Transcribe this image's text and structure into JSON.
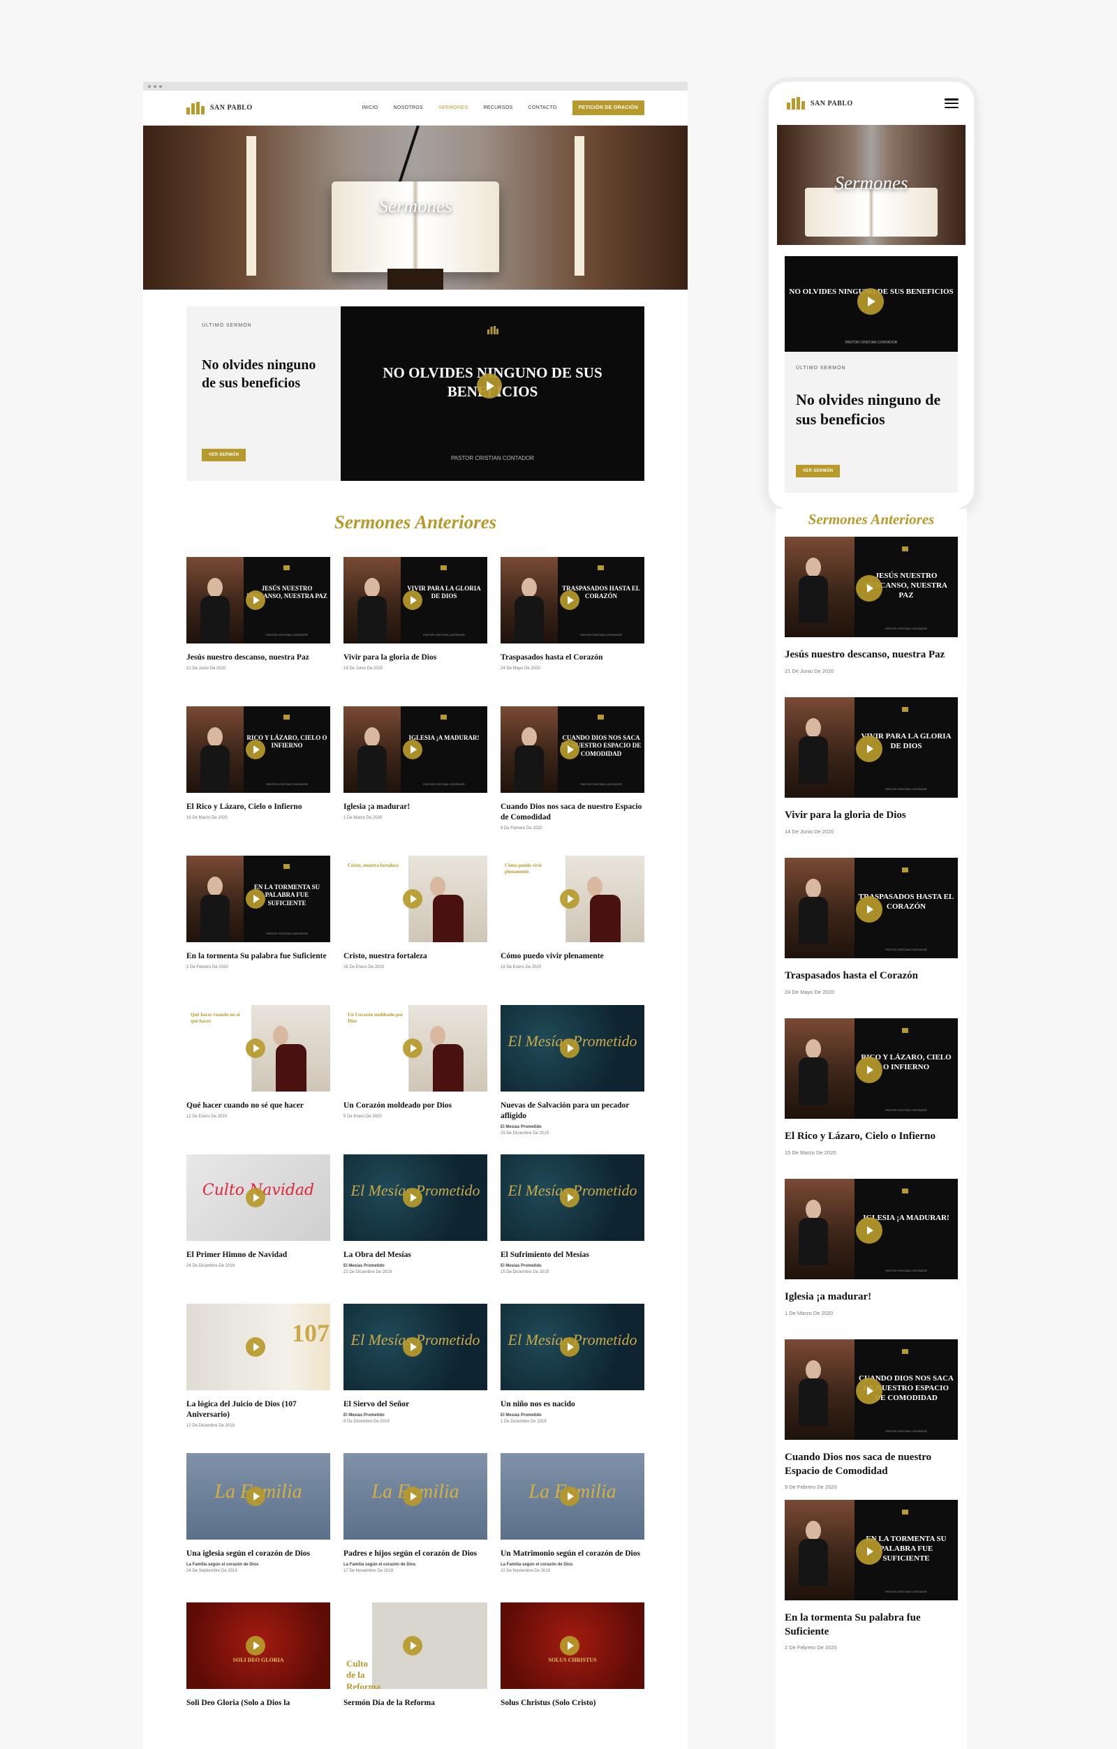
{
  "brand": {
    "name": "SAN PABLO",
    "accent": "#b79a2b"
  },
  "nav": {
    "items": [
      "INICIO",
      "NOSOTROS",
      "SERMONES",
      "RECURSOS",
      "CONTACTO"
    ],
    "cta": "PETICIÓN DE ORACIÓN"
  },
  "hero": {
    "title": "Sermones"
  },
  "latest": {
    "eyebrow": "ÚLTIMO SERMÓN",
    "title": "No olvides ninguno de sus beneficios",
    "button": "VER SERMÓN",
    "video_title": "NO OLVIDES NINGUNO DE SUS BENEFICIOS",
    "video_subtitle": "PASTOR CRISTIAN CONTADOR"
  },
  "previous": {
    "title": "Sermones Anteriores",
    "items": [
      {
        "title": "Jesús nuestro descanso, nuestra Paz",
        "date": "21 De Junio De 2020",
        "thumb": "JESÚS NUESTRO DESCANSO, NUESTRA PAZ",
        "style": "dark"
      },
      {
        "title": "Vivir para la gloria de Dios",
        "date": "14 De Junio De 2020",
        "thumb": "VIVIR PARA LA GLORIA DE DIOS",
        "style": "dark"
      },
      {
        "title": "Traspasados hasta el Corazón",
        "date": "24 De Mayo De 2020",
        "thumb": "TRASPASADOS HASTA EL CORAZÓN",
        "style": "dark"
      },
      {
        "title": "El Rico y Lázaro, Cielo o Infierno",
        "date": "15 De Marzo De 2020",
        "thumb": "RICO Y LÁZARO, CIELO O INFIERNO",
        "style": "dark"
      },
      {
        "title": "Iglesia ¡a madurar!",
        "date": "1 De Marzo De 2020",
        "thumb": "IGLESIA ¡A MADURAR!",
        "style": "dark"
      },
      {
        "title": "Cuando Dios nos saca de nuestro Espacio de Comodidad",
        "date": "9 De Febrero De 2020",
        "thumb": "CUANDO DIOS NOS SACA DE NUESTRO ESPACIO DE COMODIDAD",
        "style": "dark"
      },
      {
        "title": "En la tormenta Su palabra fue Suficiente",
        "date": "2 De Febrero De 2020",
        "thumb": "EN LA TORMENTA SU PALABRA FUE SUFICIENTE",
        "style": "dark"
      },
      {
        "title": "Cristo, nuestra fortaleza",
        "date": "26 De Enero De 2020",
        "thumb": "Cristo, nuestra fortaleza",
        "style": "light"
      },
      {
        "title": "Cómo puedo vivir plenamente",
        "date": "19 De Enero De 2020",
        "thumb": "Cómo puedo vivir plenamente",
        "style": "light"
      },
      {
        "title": "Qué hacer cuando no sé que hacer",
        "date": "12 De Enero De 2020",
        "thumb": "Qué hacer cuando no sé que hacer",
        "style": "light"
      },
      {
        "title": "Un Corazón moldeado por Dios",
        "date": "5 De Enero De 2020",
        "thumb": "Un Corazón moldeado por Dios",
        "style": "light"
      },
      {
        "title": "Nuevas de Salvación para un pecador afligido",
        "series": "El Mesías Prometido",
        "date": "29 De Diciembre De 2019",
        "thumb": "El Mesías Prometido",
        "style": "navy"
      },
      {
        "title": "El Primer Himno de Navidad",
        "date": "24 De Diciembre De 2019",
        "thumb": "Culto Navidad",
        "style": "gray"
      },
      {
        "title": "La Obra del Mesías",
        "series": "El Mesías Prometido",
        "date": "22 De Diciembre De 2019",
        "thumb": "El Mesías Prometido",
        "style": "navy"
      },
      {
        "title": "El Sufrimiento del Mesías",
        "series": "El Mesías Prometido",
        "date": "15 De Diciembre De 2019",
        "thumb": "El Mesías Prometido",
        "style": "navy"
      },
      {
        "title": "La lógica del Juicio de Dios (107 Aniversario)",
        "date": "12 De Diciembre De 2019",
        "thumb": "107",
        "style": "cream"
      },
      {
        "title": "El Siervo del Señor",
        "series": "El Mesías Prometido",
        "date": "8 De Diciembre De 2019",
        "thumb": "El Mesías Prometido",
        "style": "navy"
      },
      {
        "title": "Un niño nos es nacido",
        "series": "El Mesías Prometido",
        "date": "1 De Diciembre De 2019",
        "thumb": "El Mesías Prometido",
        "style": "navy"
      },
      {
        "title": "Una iglesia según el corazón de Dios",
        "series": "La Familia según el corazón de Dios",
        "date": "24 De Septiembre De 2019",
        "thumb": "La Familia",
        "style": "slate"
      },
      {
        "title": "Padres e hijos según el corazón de Dios",
        "series": "La Familia según el corazón de Dios",
        "date": "17 De Noviembre De 2019",
        "thumb": "La Familia",
        "style": "slate"
      },
      {
        "title": "Un Matrimonio según el corazón de Dios",
        "series": "La Familia según el corazón de Dios",
        "date": "10 De Noviembre De 2019",
        "thumb": "La Familia",
        "style": "slate"
      },
      {
        "title": "Soli Deo Gloria (Solo a Dios la",
        "date": "",
        "thumb": "SOLI DEO GLORIA",
        "style": "red"
      },
      {
        "title": "Sermón Día de la Reforma",
        "date": "",
        "thumb": "Culto de la Reforma",
        "style": "mixed"
      },
      {
        "title": "Solus Christus (Solo Cristo)",
        "date": "",
        "thumb": "SOLUS CHRISTUS",
        "style": "red"
      }
    ]
  },
  "mobile_list": [
    {
      "title": "Jesús nuestro descanso, nuestra Paz",
      "date": "21 De Junio De 2020",
      "thumb": "JESÚS NUESTRO DESCANSO, NUESTRA PAZ"
    },
    {
      "title": "Vivir para la gloria de Dios",
      "date": "14 De Junio De 2020",
      "thumb": "VIVIR PARA LA GLORIA DE DIOS"
    },
    {
      "title": "Traspasados hasta el Corazón",
      "date": "24 De Mayo De 2020",
      "thumb": "TRASPASADOS HASTA EL CORAZÓN"
    },
    {
      "title": "El Rico y Lázaro, Cielo o Infierno",
      "date": "15 De Marzo De 2020",
      "thumb": "RICO Y LÁZARO, CIELO O INFIERNO"
    },
    {
      "title": "Iglesia ¡a madurar!",
      "date": "1 De Marzo De 2020",
      "thumb": "IGLESIA ¡A MADURAR!"
    },
    {
      "title": "Cuando Dios nos saca de nuestro Espacio de Comodidad",
      "date": "9 De Febrero De 2020",
      "thumb": "CUANDO DIOS NOS SACA DE NUESTRO ESPACIO DE COMODIDAD"
    },
    {
      "title": "En la tormenta Su palabra fue Suficiente",
      "date": "2 De Febrero De 2020",
      "thumb": "EN LA TORMENTA SU PALABRA FUE SUFICIENTE"
    }
  ],
  "thumb_credit": "PASTOR CRISTIAN CONTADOR"
}
